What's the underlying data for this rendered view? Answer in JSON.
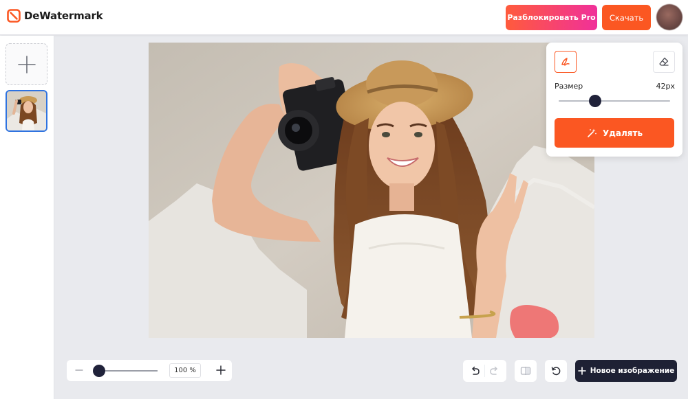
{
  "header": {
    "logo_text": "DeWatermark",
    "unlock_pro_label": "Разблокировать Pro",
    "download_label": "Скачать"
  },
  "colors": {
    "accent": "#fb5722",
    "pro_gradient_start": "#ff5b3c",
    "pro_gradient_end": "#f0309a",
    "dark": "#1e2134",
    "selection": "#2f73e0"
  },
  "icons": {
    "logo": "dewatermark-logo-icon",
    "add": "plus-icon",
    "brush": "brush-icon",
    "eraser": "eraser-icon",
    "remove": "magic-wand-icon",
    "zoom_out": "minus-icon",
    "zoom_in": "plus-icon",
    "undo": "undo-icon",
    "redo": "redo-icon",
    "compare": "compare-icon",
    "reset": "reset-icon",
    "new_image": "plus-icon"
  },
  "brush_panel": {
    "size_label": "Размер",
    "size_value": "42px",
    "size_fraction": 0.33,
    "remove_label": "Удалять"
  },
  "zoom": {
    "value": "100 %"
  },
  "toolbar": {
    "new_image_label": "Новое изображение",
    "redo_enabled": false
  }
}
